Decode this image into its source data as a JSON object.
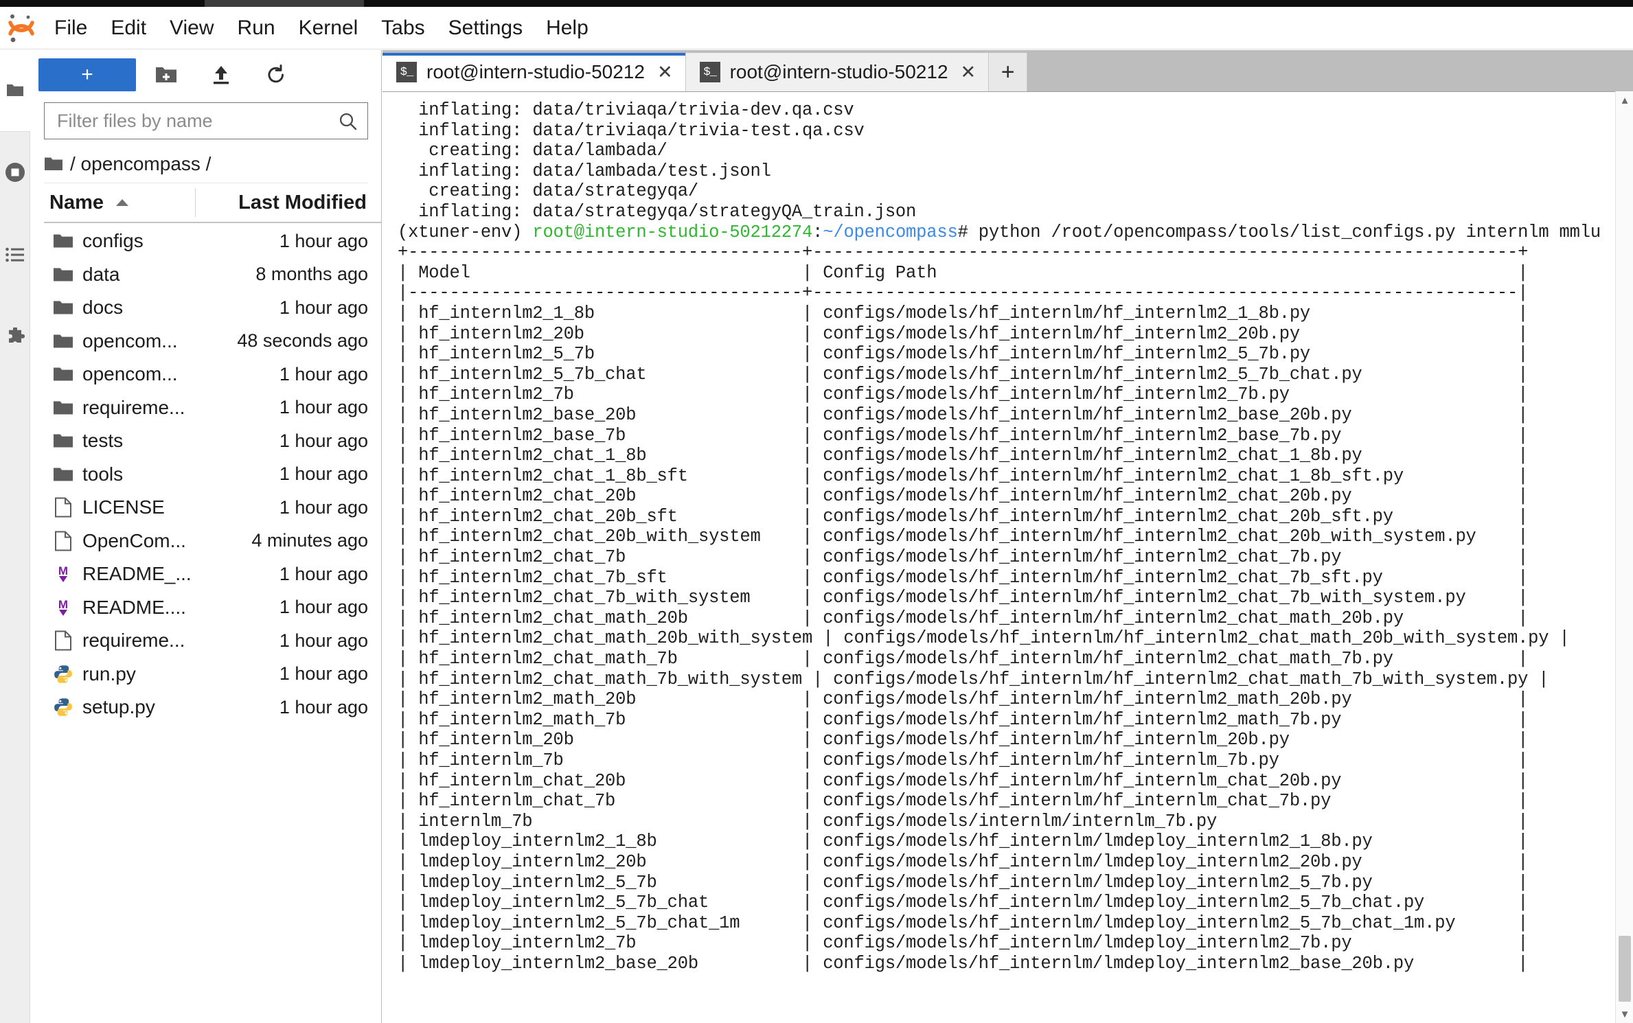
{
  "menubar": {
    "logo_icon": "jupyter-logo-icon",
    "items": [
      {
        "label": "File"
      },
      {
        "label": "Edit"
      },
      {
        "label": "View"
      },
      {
        "label": "Run"
      },
      {
        "label": "Kernel"
      },
      {
        "label": "Tabs"
      },
      {
        "label": "Settings"
      },
      {
        "label": "Help"
      }
    ]
  },
  "activity_bar": {
    "items": [
      {
        "icon": "folder-icon",
        "name": "file-browser"
      },
      {
        "icon": "stop-circle-icon",
        "name": "running-terminals-kernels"
      },
      {
        "icon": "list-icon",
        "name": "table-of-contents"
      },
      {
        "icon": "puzzle-icon",
        "name": "extension-manager"
      }
    ]
  },
  "filebrowser": {
    "toolbar": {
      "new_launcher_label": "+",
      "new_folder_icon": "new-folder-icon",
      "upload_icon": "upload-icon",
      "refresh_icon": "refresh-icon"
    },
    "filter_placeholder": "Filter files by name",
    "filter_value": "",
    "search_icon": "search-icon",
    "breadcrumb": "/ opencompass /",
    "breadcrumb_icon": "folder-icon",
    "columns": {
      "name": "Name",
      "last_modified": "Last Modified",
      "sort_icon": "sort-ascending-icon"
    },
    "rows": [
      {
        "name": "configs",
        "modified": "1 hour ago",
        "icon": "folder-icon"
      },
      {
        "name": "data",
        "modified": "8 months ago",
        "icon": "folder-icon"
      },
      {
        "name": "docs",
        "modified": "1 hour ago",
        "icon": "folder-icon"
      },
      {
        "name": "opencom...",
        "modified": "48 seconds ago",
        "icon": "folder-icon"
      },
      {
        "name": "opencom...",
        "modified": "1 hour ago",
        "icon": "folder-icon"
      },
      {
        "name": "requireme...",
        "modified": "1 hour ago",
        "icon": "folder-icon"
      },
      {
        "name": "tests",
        "modified": "1 hour ago",
        "icon": "folder-icon"
      },
      {
        "name": "tools",
        "modified": "1 hour ago",
        "icon": "folder-icon"
      },
      {
        "name": "LICENSE",
        "modified": "1 hour ago",
        "icon": "file-icon"
      },
      {
        "name": "OpenCom...",
        "modified": "4 minutes ago",
        "icon": "file-icon"
      },
      {
        "name": "README_...",
        "modified": "1 hour ago",
        "icon": "markdown-icon"
      },
      {
        "name": "README....",
        "modified": "1 hour ago",
        "icon": "markdown-icon"
      },
      {
        "name": "requireme...",
        "modified": "1 hour ago",
        "icon": "file-icon"
      },
      {
        "name": "run.py",
        "modified": "1 hour ago",
        "icon": "python-icon"
      },
      {
        "name": "setup.py",
        "modified": "1 hour ago",
        "icon": "python-icon"
      }
    ]
  },
  "dock": {
    "tabs": [
      {
        "label": "root@intern-studio-50212",
        "icon": "terminal-icon",
        "close_icon": "✕",
        "active": true
      },
      {
        "label": "root@intern-studio-50212",
        "icon": "terminal-icon",
        "close_icon": "✕",
        "active": false
      }
    ],
    "add_tab_label": "+"
  },
  "terminal": {
    "scroll_up_icon": "▲",
    "scroll_down_icon": "▼",
    "preamble_lines": [
      "  inflating: data/triviaqa/trivia-dev.qa.csv",
      "  inflating: data/triviaqa/trivia-test.qa.csv",
      "   creating: data/lambada/",
      "  inflating: data/lambada/test.jsonl",
      "   creating: data/strategyqa/",
      "  inflating: data/strategyqa/strategyQA_train.json"
    ],
    "prompt": {
      "env": "(xtuner-env) ",
      "user_host": "root@intern-studio-50212274",
      "colon": ":",
      "path": "~/opencompass",
      "sigil": "# ",
      "command": "python /root/opencompass/tools/list_configs.py internlm mmlu"
    },
    "table": {
      "top_border": "+--------------------------------------+--------------------------------------------------------------------+",
      "header_sep": "|--------------------------------------+--------------------------------------------------------------------|",
      "headers": [
        "Model",
        "Config Path"
      ],
      "rows": [
        [
          "hf_internlm2_1_8b",
          "configs/models/hf_internlm/hf_internlm2_1_8b.py"
        ],
        [
          "hf_internlm2_20b",
          "configs/models/hf_internlm/hf_internlm2_20b.py"
        ],
        [
          "hf_internlm2_5_7b",
          "configs/models/hf_internlm/hf_internlm2_5_7b.py"
        ],
        [
          "hf_internlm2_5_7b_chat",
          "configs/models/hf_internlm/hf_internlm2_5_7b_chat.py"
        ],
        [
          "hf_internlm2_7b",
          "configs/models/hf_internlm/hf_internlm2_7b.py"
        ],
        [
          "hf_internlm2_base_20b",
          "configs/models/hf_internlm/hf_internlm2_base_20b.py"
        ],
        [
          "hf_internlm2_base_7b",
          "configs/models/hf_internlm/hf_internlm2_base_7b.py"
        ],
        [
          "hf_internlm2_chat_1_8b",
          "configs/models/hf_internlm/hf_internlm2_chat_1_8b.py"
        ],
        [
          "hf_internlm2_chat_1_8b_sft",
          "configs/models/hf_internlm/hf_internlm2_chat_1_8b_sft.py"
        ],
        [
          "hf_internlm2_chat_20b",
          "configs/models/hf_internlm/hf_internlm2_chat_20b.py"
        ],
        [
          "hf_internlm2_chat_20b_sft",
          "configs/models/hf_internlm/hf_internlm2_chat_20b_sft.py"
        ],
        [
          "hf_internlm2_chat_20b_with_system",
          "configs/models/hf_internlm/hf_internlm2_chat_20b_with_system.py"
        ],
        [
          "hf_internlm2_chat_7b",
          "configs/models/hf_internlm/hf_internlm2_chat_7b.py"
        ],
        [
          "hf_internlm2_chat_7b_sft",
          "configs/models/hf_internlm/hf_internlm2_chat_7b_sft.py"
        ],
        [
          "hf_internlm2_chat_7b_with_system",
          "configs/models/hf_internlm/hf_internlm2_chat_7b_with_system.py"
        ],
        [
          "hf_internlm2_chat_math_20b",
          "configs/models/hf_internlm/hf_internlm2_chat_math_20b.py"
        ],
        [
          "hf_internlm2_chat_math_20b_with_system",
          "configs/models/hf_internlm/hf_internlm2_chat_math_20b_with_system.py"
        ],
        [
          "hf_internlm2_chat_math_7b",
          "configs/models/hf_internlm/hf_internlm2_chat_math_7b.py"
        ],
        [
          "hf_internlm2_chat_math_7b_with_system",
          "configs/models/hf_internlm/hf_internlm2_chat_math_7b_with_system.py"
        ],
        [
          "hf_internlm2_math_20b",
          "configs/models/hf_internlm/hf_internlm2_math_20b.py"
        ],
        [
          "hf_internlm2_math_7b",
          "configs/models/hf_internlm/hf_internlm2_math_7b.py"
        ],
        [
          "hf_internlm_20b",
          "configs/models/hf_internlm/hf_internlm_20b.py"
        ],
        [
          "hf_internlm_7b",
          "configs/models/hf_internlm/hf_internlm_7b.py"
        ],
        [
          "hf_internlm_chat_20b",
          "configs/models/hf_internlm/hf_internlm_chat_20b.py"
        ],
        [
          "hf_internlm_chat_7b",
          "configs/models/hf_internlm/hf_internlm_chat_7b.py"
        ],
        [
          "internlm_7b",
          "configs/models/internlm/internlm_7b.py"
        ],
        [
          "lmdeploy_internlm2_1_8b",
          "configs/models/hf_internlm/lmdeploy_internlm2_1_8b.py"
        ],
        [
          "lmdeploy_internlm2_20b",
          "configs/models/hf_internlm/lmdeploy_internlm2_20b.py"
        ],
        [
          "lmdeploy_internlm2_5_7b",
          "configs/models/hf_internlm/lmdeploy_internlm2_5_7b.py"
        ],
        [
          "lmdeploy_internlm2_5_7b_chat",
          "configs/models/hf_internlm/lmdeploy_internlm2_5_7b_chat.py"
        ],
        [
          "lmdeploy_internlm2_5_7b_chat_1m",
          "configs/models/hf_internlm/lmdeploy_internlm2_5_7b_chat_1m.py"
        ],
        [
          "lmdeploy_internlm2_7b",
          "configs/models/hf_internlm/lmdeploy_internlm2_7b.py"
        ],
        [
          "lmdeploy_internlm2_base_20b",
          "configs/models/hf_internlm/lmdeploy_internlm2_base_20b.py"
        ]
      ]
    }
  }
}
